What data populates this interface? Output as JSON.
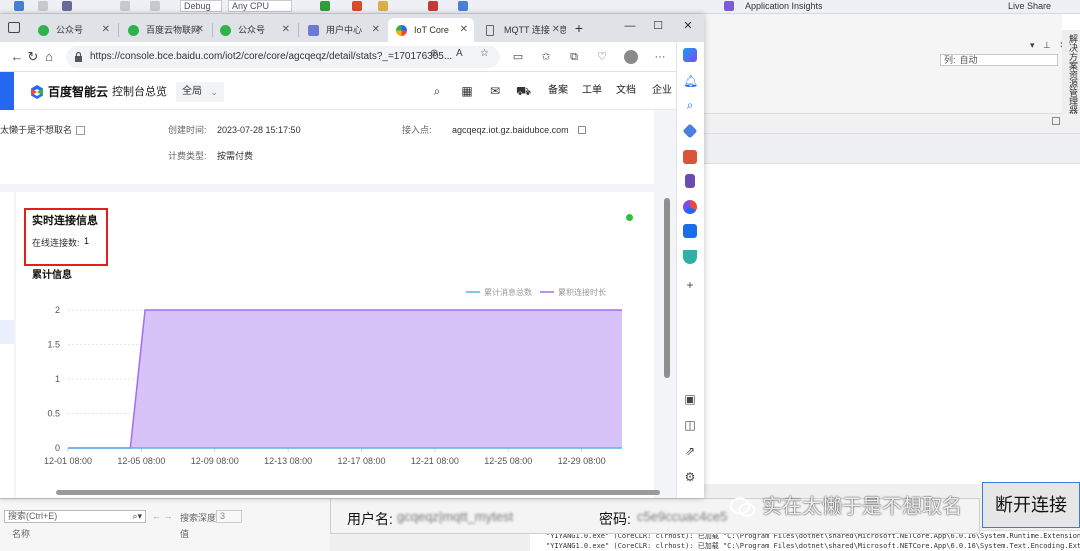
{
  "vs": {
    "toolbar": {
      "config": "Debug",
      "platform": "Any CPU",
      "app_insights": "Application Insights",
      "live_share": "Live Share"
    },
    "column_label": "列:",
    "column_value": "自动",
    "side_tab": "解决方案资源管理器",
    "locals": {
      "search_placeholder": "搜索(Ctrl+E)",
      "depth_label": "搜索深度:",
      "depth_value": "3",
      "col_name": "名称",
      "col_value": "值"
    },
    "output_lines": [
      "\"YIYANG1.0.exe\" (CoreCLR: clrhost): 已加载 \"C:\\Program Files\\dotnet\\shared\\Microsoft.NETCore.App\\6.0.16\\System.Runtime.Extensions.dll\"",
      "\"YIYANG1.0.exe\" (CoreCLR: clrhost): 已加载 \"C:\\Program Files\\dotnet\\shared\\Microsoft.NETCore.App\\6.0.16\\System.Text.Encoding.Extensions.dll\""
    ]
  },
  "app_form": {
    "username_label": "用户名:",
    "username_value": "gcqeqz|mqtt_mytest",
    "password_label": "密码:",
    "password_value": "c5e9ccuac4ce5",
    "connect_button": "断开连接"
  },
  "watermark": "实在太懒于是不想取名",
  "browser": {
    "tabs": [
      {
        "title": "公众号",
        "color": "#2fb14c"
      },
      {
        "title": "百度云物联网",
        "color": "#2fb14c"
      },
      {
        "title": "公众号",
        "color": "#2fb14c"
      },
      {
        "title": "用户中心",
        "color": "#6a7bd1"
      },
      {
        "title": "IoT Core",
        "color": "#2468f2"
      },
      {
        "title": "MQTT 连接信息",
        "color": "#666666"
      }
    ],
    "url": "https://console.bce.baidu.com/iot2/core/core/agcqeqz/detail/stats?_=170176305..."
  },
  "console": {
    "logo": "百度智能云",
    "home": "控制台总览",
    "region": "全局",
    "links": [
      "备案",
      "工单",
      "文档",
      "企业"
    ]
  },
  "instance": {
    "name": "太懒于是不想取名",
    "created_label": "创建时间:",
    "created_value": "2023-07-28 15:17:50",
    "endpoint_label": "接入点:",
    "endpoint_value": "agcqeqz.iot.gz.baidubce.com",
    "billing_label": "计费类型:",
    "billing_value": "按需付费"
  },
  "realtime": {
    "title": "实时连接信息",
    "online_label": "在线连接数:",
    "online_value": "1"
  },
  "cumulative": {
    "title": "累计信息"
  },
  "chart_data": {
    "type": "area",
    "x": [
      "12-01 08:00",
      "12-03 08:00",
      "12-04 08:00",
      "12-05 08:00",
      "12-06 08:00",
      "12-07 08:00",
      "12-09 08:00",
      "12-13 08:00",
      "12-17 08:00",
      "12-21 08:00",
      "12-25 08:00",
      "12-29 08:00",
      "12-31 08:00"
    ],
    "tick_labels": [
      "12-01 08:00",
      "12-05 08:00",
      "12-09 08:00",
      "12-13 08:00",
      "12-17 08:00",
      "12-21 08:00",
      "12-25 08:00",
      "12-29 08:00"
    ],
    "x_day_range": [
      0,
      30.2
    ],
    "series": [
      {
        "name": "累计消息总数",
        "color": "#5ab4e6",
        "points": [
          [
            0,
            0
          ],
          [
            30.2,
            0
          ]
        ]
      },
      {
        "name": "累积连接时长",
        "color": "#a36ef0",
        "points": [
          [
            0,
            0
          ],
          [
            3.4,
            0
          ],
          [
            4.2,
            2
          ],
          [
            30.2,
            2
          ]
        ]
      }
    ],
    "ylim": [
      0,
      2
    ],
    "yticks": [
      0,
      0.5,
      1,
      1.5,
      2
    ],
    "ytick_labels": [
      "0",
      "0.5",
      "1",
      "1.5",
      "2"
    ],
    "grid": true,
    "legend": "top-right"
  }
}
